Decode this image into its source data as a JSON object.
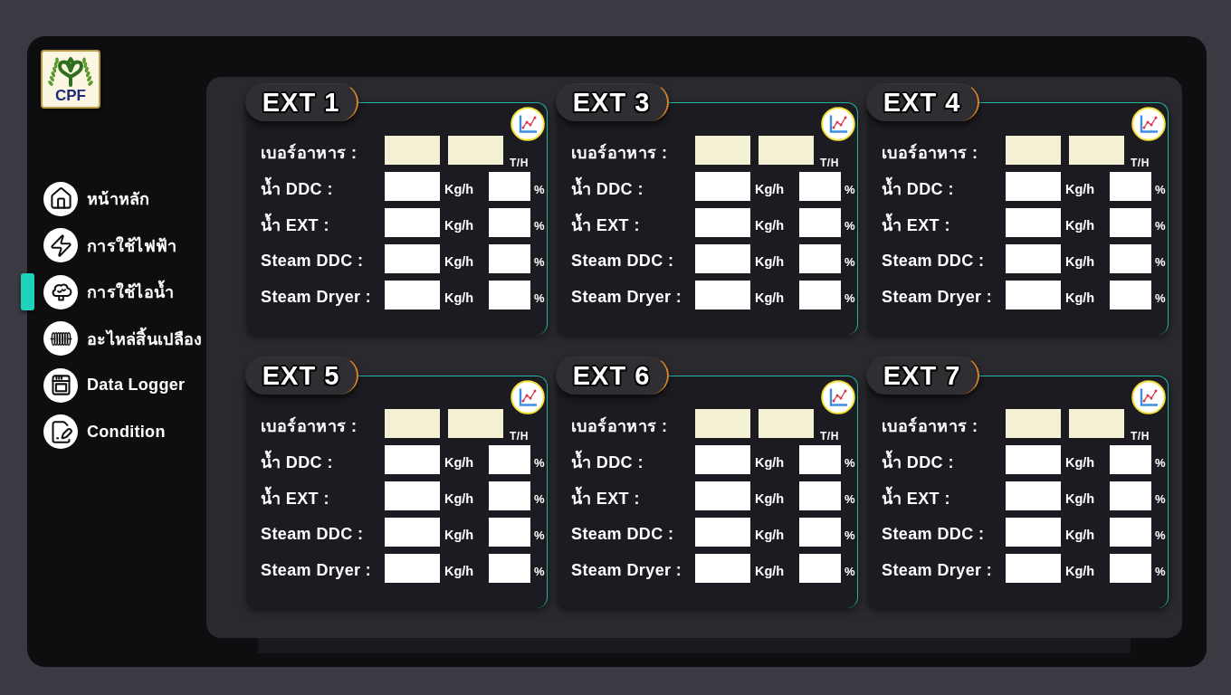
{
  "logo": {
    "label": "CPF"
  },
  "sidebar": {
    "items": [
      {
        "label": "หน้าหลัก",
        "selected": false
      },
      {
        "label": "การใช้ไฟฟ้า",
        "selected": false
      },
      {
        "label": "การใช้ไอน้ำ",
        "selected": true
      },
      {
        "label": "อะไหล่สิ้นเปลือง",
        "selected": false
      },
      {
        "label": "Data Logger",
        "selected": false
      },
      {
        "label": "Condition",
        "selected": false
      }
    ]
  },
  "panels": [
    {
      "title": "EXT 1",
      "rows": [
        {
          "kind": "feed",
          "label": "เบอร์อาหาร :",
          "unit": "T/H"
        },
        {
          "kind": "flow",
          "label": "น้ำ DDC :",
          "unit": "Kg/h",
          "percent_unit": "%"
        },
        {
          "kind": "flow",
          "label": "น้ำ EXT :",
          "unit": "Kg/h",
          "percent_unit": "%"
        },
        {
          "kind": "flow",
          "label": "Steam DDC :",
          "unit": "Kg/h",
          "percent_unit": "%"
        },
        {
          "kind": "flow",
          "label": "Steam Dryer :",
          "unit": "Kg/h",
          "percent_unit": "%"
        }
      ]
    },
    {
      "title": "EXT 3",
      "rows": [
        {
          "kind": "feed",
          "label": "เบอร์อาหาร :",
          "unit": "T/H"
        },
        {
          "kind": "flow",
          "label": "น้ำ DDC :",
          "unit": "Kg/h",
          "percent_unit": "%"
        },
        {
          "kind": "flow",
          "label": "น้ำ EXT :",
          "unit": "Kg/h",
          "percent_unit": "%"
        },
        {
          "kind": "flow",
          "label": "Steam DDC :",
          "unit": "Kg/h",
          "percent_unit": "%"
        },
        {
          "kind": "flow",
          "label": "Steam Dryer :",
          "unit": "Kg/h",
          "percent_unit": "%"
        }
      ]
    },
    {
      "title": "EXT 4",
      "rows": [
        {
          "kind": "feed",
          "label": "เบอร์อาหาร :",
          "unit": "T/H"
        },
        {
          "kind": "flow",
          "label": "น้ำ DDC :",
          "unit": "Kg/h",
          "percent_unit": "%"
        },
        {
          "kind": "flow",
          "label": "น้ำ EXT :",
          "unit": "Kg/h",
          "percent_unit": "%"
        },
        {
          "kind": "flow",
          "label": "Steam DDC :",
          "unit": "Kg/h",
          "percent_unit": "%"
        },
        {
          "kind": "flow",
          "label": "Steam Dryer :",
          "unit": "Kg/h",
          "percent_unit": "%"
        }
      ]
    },
    {
      "title": "EXT 5",
      "rows": [
        {
          "kind": "feed",
          "label": "เบอร์อาหาร :",
          "unit": "T/H"
        },
        {
          "kind": "flow",
          "label": "น้ำ DDC :",
          "unit": "Kg/h",
          "percent_unit": "%"
        },
        {
          "kind": "flow",
          "label": "น้ำ EXT :",
          "unit": "Kg/h",
          "percent_unit": "%"
        },
        {
          "kind": "flow",
          "label": "Steam DDC :",
          "unit": "Kg/h",
          "percent_unit": "%"
        },
        {
          "kind": "flow",
          "label": "Steam Dryer :",
          "unit": "Kg/h",
          "percent_unit": "%"
        }
      ]
    },
    {
      "title": "EXT 6",
      "rows": [
        {
          "kind": "feed",
          "label": "เบอร์อาหาร :",
          "unit": "T/H"
        },
        {
          "kind": "flow",
          "label": "น้ำ DDC :",
          "unit": "Kg/h",
          "percent_unit": "%"
        },
        {
          "kind": "flow",
          "label": "น้ำ EXT :",
          "unit": "Kg/h",
          "percent_unit": "%"
        },
        {
          "kind": "flow",
          "label": "Steam DDC :",
          "unit": "Kg/h",
          "percent_unit": "%"
        },
        {
          "kind": "flow",
          "label": "Steam Dryer :",
          "unit": "Kg/h",
          "percent_unit": "%"
        }
      ]
    },
    {
      "title": "EXT 7",
      "rows": [
        {
          "kind": "feed",
          "label": "เบอร์อาหาร :",
          "unit": "T/H"
        },
        {
          "kind": "flow",
          "label": "น้ำ DDC :",
          "unit": "Kg/h",
          "percent_unit": "%"
        },
        {
          "kind": "flow",
          "label": "น้ำ EXT :",
          "unit": "Kg/h",
          "percent_unit": "%"
        },
        {
          "kind": "flow",
          "label": "Steam DDC :",
          "unit": "Kg/h",
          "percent_unit": "%"
        },
        {
          "kind": "flow",
          "label": "Steam Dryer :",
          "unit": "Kg/h",
          "percent_unit": "%"
        }
      ]
    }
  ]
}
